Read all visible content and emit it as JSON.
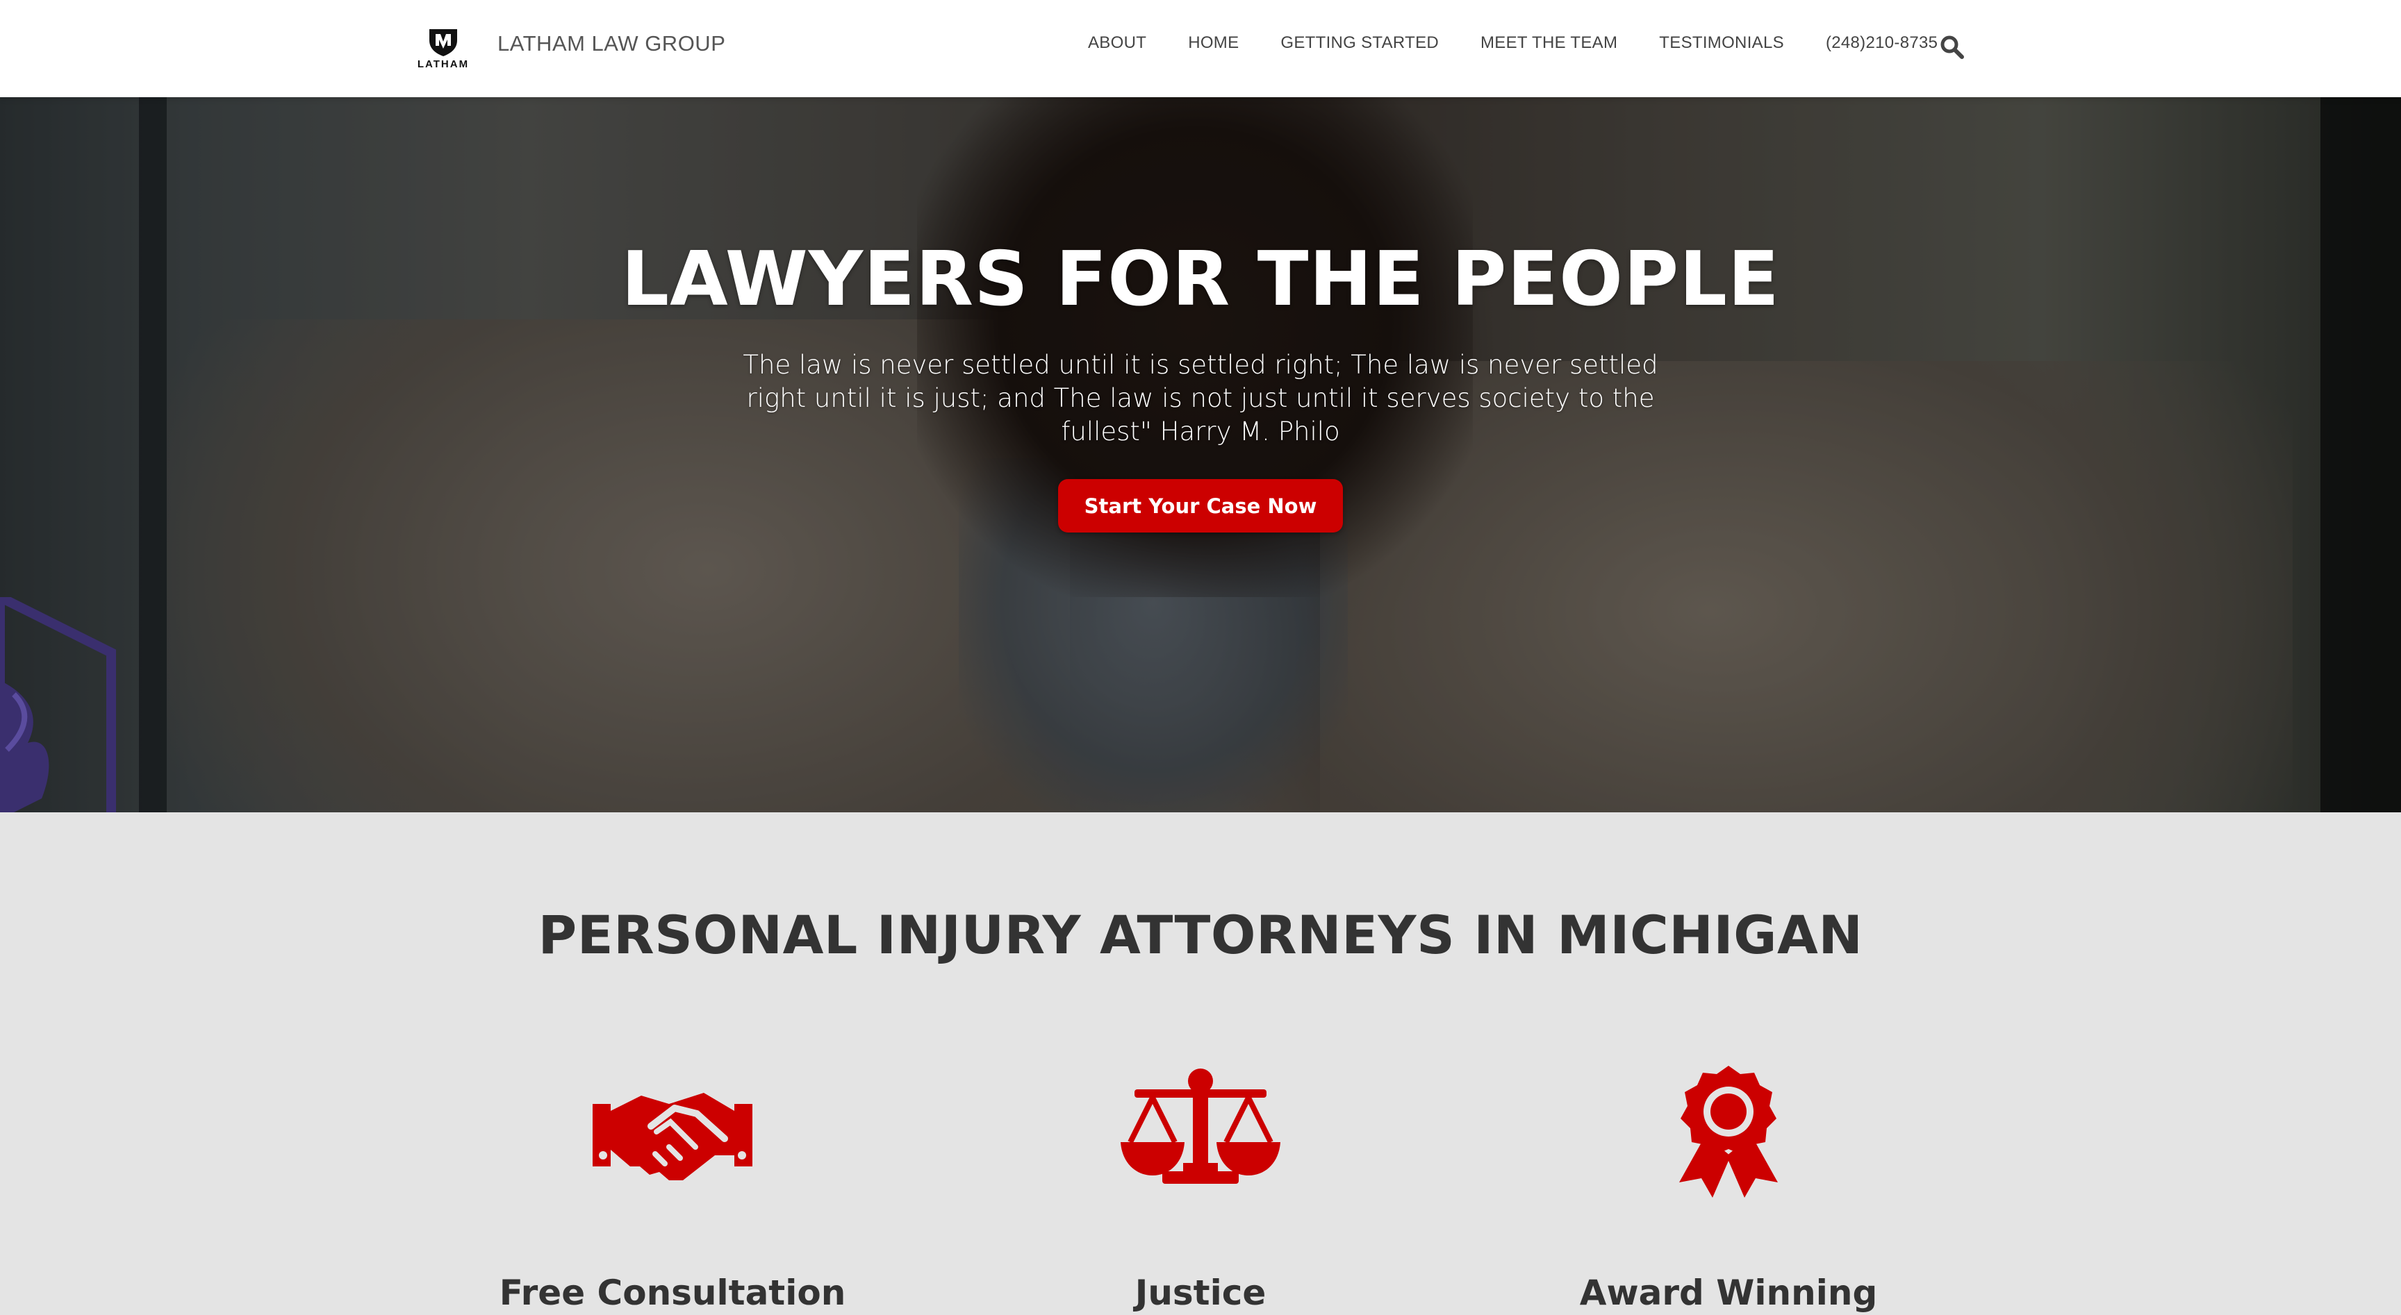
{
  "header": {
    "brand_logo_text": "LATHAM",
    "brand_name": "LATHAM LAW GROUP",
    "nav": [
      {
        "label": "ABOUT"
      },
      {
        "label": "HOME"
      },
      {
        "label": "GETTING STARTED"
      },
      {
        "label": "MEET THE TEAM"
      },
      {
        "label": "TESTIMONIALS"
      },
      {
        "label": "(248)210-8735"
      }
    ],
    "search_icon": "search-icon"
  },
  "hero": {
    "title": "LAWYERS FOR THE PEOPLE",
    "quote": "The law is never settled until it is settled right; The law is never settled right until it is just; and The law is not just until it serves society to the fullest\" Harry M. Philo",
    "cta_label": "Start Your Case Now"
  },
  "section": {
    "title": "PERSONAL INJURY ATTORNEYS IN MICHIGAN",
    "features": [
      {
        "title": "Free Consultation",
        "icon": "handshake-icon"
      },
      {
        "title": "Justice",
        "icon": "scales-icon"
      },
      {
        "title": "Award Winning",
        "icon": "award-ribbon-icon"
      }
    ]
  },
  "colors": {
    "accent": "#cc0000",
    "text_dark": "#333333",
    "section_bg": "#e4e4e4"
  }
}
